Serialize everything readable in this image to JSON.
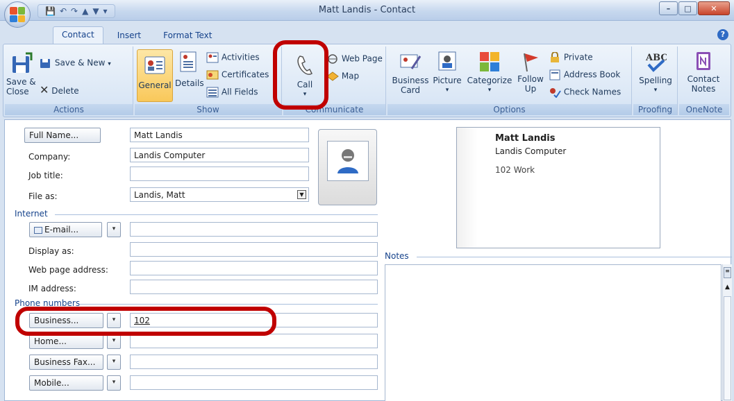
{
  "window": {
    "title": "Matt Landis - Contact",
    "minimize": "–",
    "maximize": "□",
    "close": "✕"
  },
  "tabs": [
    {
      "label": "Contact",
      "active": true
    },
    {
      "label": "Insert",
      "active": false
    },
    {
      "label": "Format Text",
      "active": false
    }
  ],
  "ribbon": {
    "actions": {
      "label": "Actions",
      "save_close": "Save &\nClose",
      "save_new": "Save & New",
      "delete": "Delete"
    },
    "show": {
      "label": "Show",
      "general": "General",
      "details": "Details",
      "activities": "Activities",
      "certificates": "Certificates",
      "all_fields": "All Fields"
    },
    "communicate": {
      "label": "Communicate",
      "call": "Call",
      "web_page": "Web Page",
      "map": "Map"
    },
    "options": {
      "label": "Options",
      "business_card": "Business\nCard",
      "picture": "Picture",
      "categorize": "Categorize",
      "follow_up": "Follow\nUp",
      "private": "Private",
      "address_book": "Address Book",
      "check_names": "Check Names"
    },
    "proofing": {
      "label": "Proofing",
      "spelling": "Spelling"
    },
    "onenote": {
      "label": "OneNote",
      "contact_notes": "Contact\nNotes"
    }
  },
  "form": {
    "full_name_button": "Full Name...",
    "full_name": "Matt Landis",
    "company_label": "Company:",
    "company": "Landis Computer",
    "job_title_label": "Job title:",
    "job_title": "",
    "file_as_label": "File as:",
    "file_as": "Landis, Matt",
    "internet_section": "Internet",
    "email_button": "E-mail...",
    "email": "",
    "display_as_label": "Display as:",
    "display_as": "",
    "web_page_label": "Web page address:",
    "web_page": "",
    "im_label": "IM address:",
    "im": "",
    "phone_section": "Phone numbers",
    "business_button": "Business...",
    "business_phone": "102",
    "home_button": "Home...",
    "home_phone": "",
    "business_fax_button": "Business Fax...",
    "business_fax": "",
    "mobile_button": "Mobile...",
    "mobile_phone": "",
    "notes_section": "Notes"
  },
  "business_card": {
    "name": "Matt Landis",
    "company": "Landis Computer",
    "phone_number": "102",
    "phone_type": "Work"
  },
  "colors": {
    "highlight": "#c00000",
    "ribbon_text": "#15428b"
  }
}
